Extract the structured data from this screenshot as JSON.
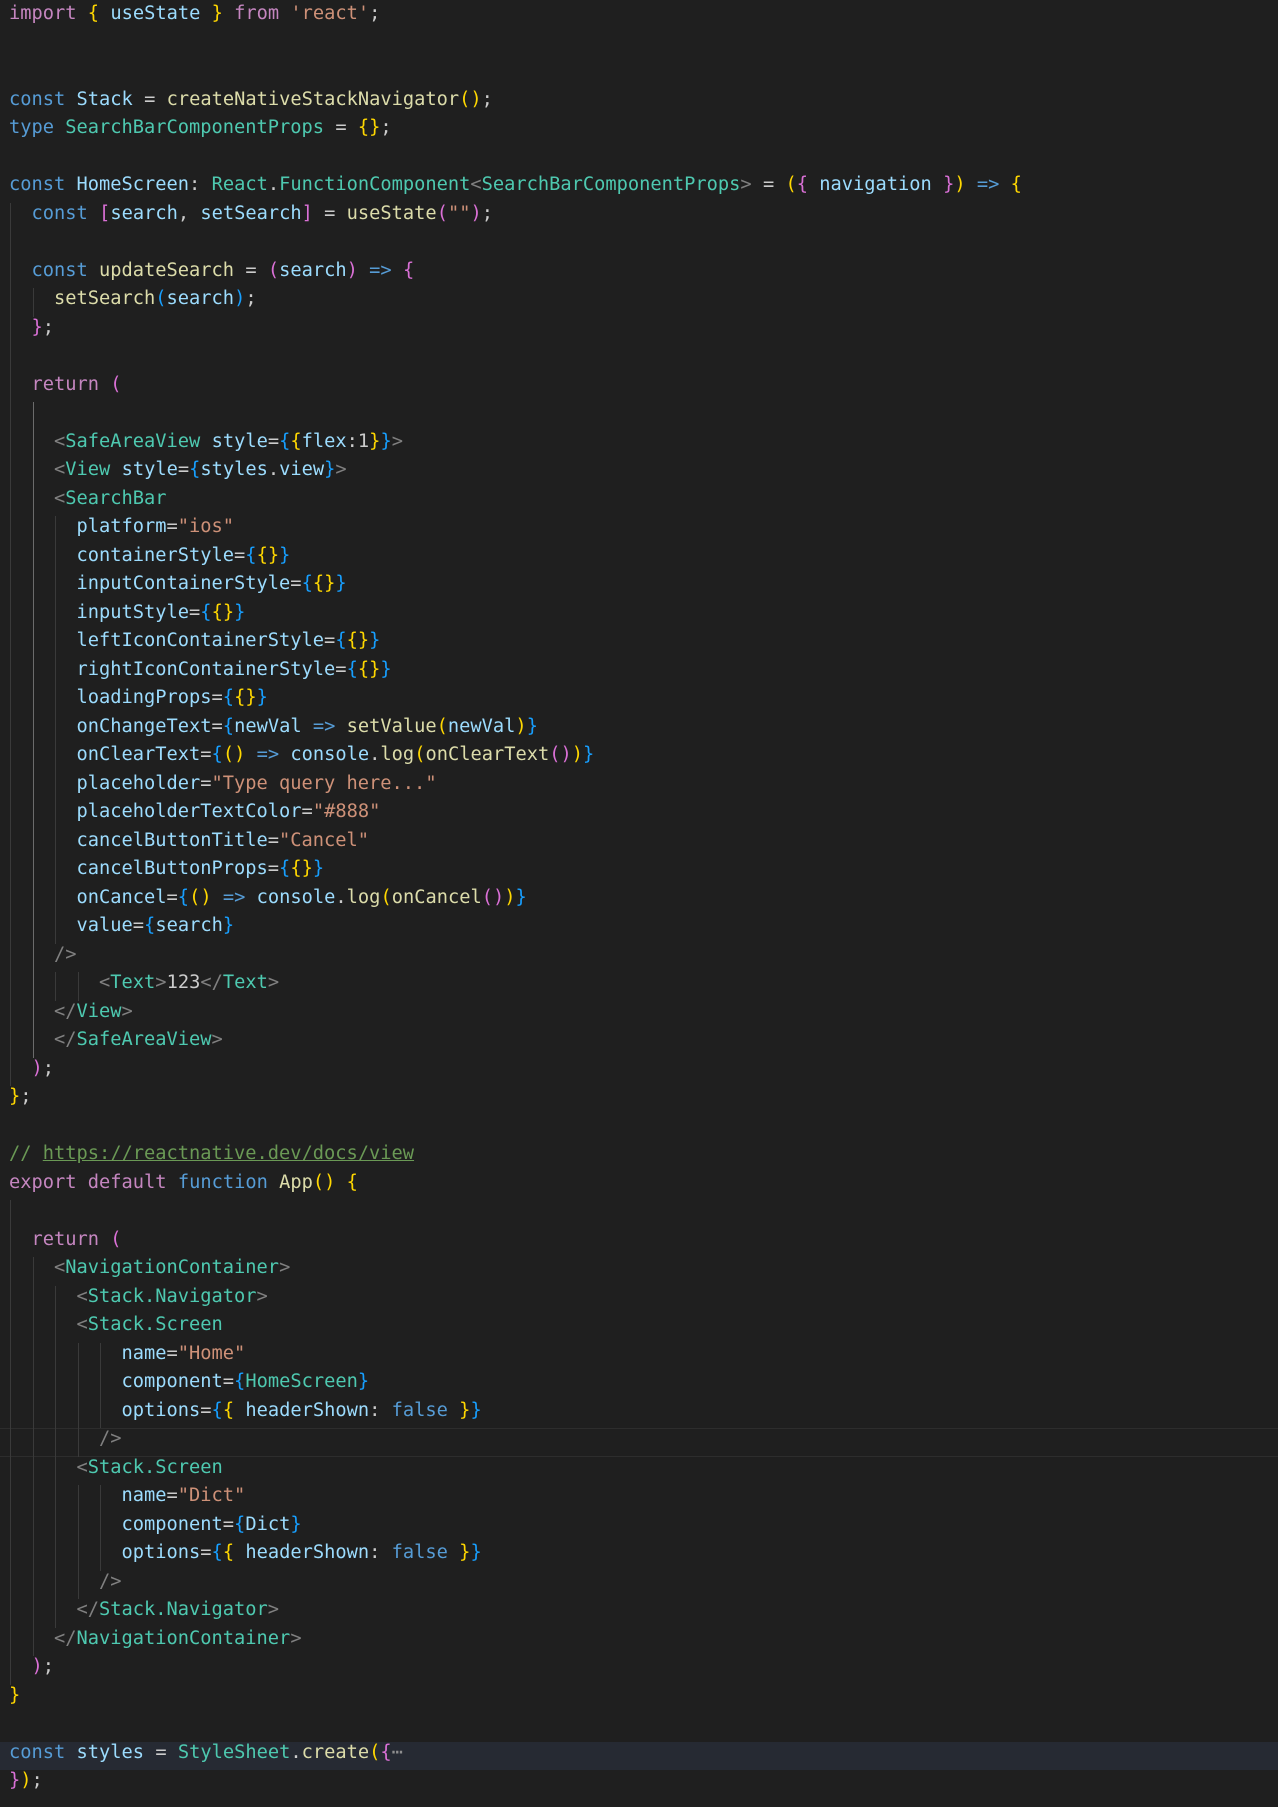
{
  "editor": {
    "language": "tsx",
    "theme": "dark",
    "lines": {
      "l1": [
        "import",
        "{",
        "useState",
        "}",
        "from",
        "'react'",
        ";"
      ],
      "l4": [
        "const",
        "Stack",
        "=",
        "createNativeStackNavigator",
        "(",
        ")",
        ";"
      ],
      "l5": [
        "type",
        "SearchBarComponentProps",
        "=",
        "{",
        "}",
        ";"
      ],
      "l7": [
        "const",
        "HomeScreen",
        ":",
        "React",
        ".",
        "FunctionComponent",
        "<",
        "SearchBarComponentProps",
        ">",
        "=",
        "(",
        "{",
        "navigation",
        "}",
        ")",
        "=>",
        "{"
      ],
      "l8": [
        "const",
        "[",
        "search",
        ", ",
        "setSearch",
        "]",
        "=",
        "useState",
        "(",
        "\"\"",
        ")",
        ";"
      ],
      "l10": [
        "const",
        "updateSearch",
        "=",
        "(",
        "search",
        ")",
        "=>",
        "{"
      ],
      "l11": [
        "setSearch",
        "(",
        "search",
        ")",
        ";"
      ],
      "l12": [
        "}",
        ";"
      ],
      "l14": [
        "return",
        "("
      ],
      "l16": [
        "<",
        "SafeAreaView",
        "style",
        "=",
        "{",
        "{",
        "flex",
        ":",
        "1",
        "}",
        "}",
        ">"
      ],
      "l17": [
        "<",
        "View",
        "style",
        "=",
        "{",
        "styles",
        ".",
        "view",
        "}",
        ">"
      ],
      "l18": [
        "<",
        "SearchBar"
      ],
      "l19": [
        "platform",
        "=",
        "\"ios\""
      ],
      "l20": [
        "containerStyle",
        "=",
        "{",
        "{",
        "}",
        "}"
      ],
      "l21": [
        "inputContainerStyle",
        "=",
        "{",
        "{",
        "}",
        "}"
      ],
      "l22": [
        "inputStyle",
        "=",
        "{",
        "{",
        "}",
        "}"
      ],
      "l23": [
        "leftIconContainerStyle",
        "=",
        "{",
        "{",
        "}",
        "}"
      ],
      "l24": [
        "rightIconContainerStyle",
        "=",
        "{",
        "{",
        "}",
        "}"
      ],
      "l25": [
        "loadingProps",
        "=",
        "{",
        "{",
        "}",
        "}"
      ],
      "l26": [
        "onChangeText",
        "=",
        "{",
        "newVal",
        "=>",
        "setValue",
        "(",
        "newVal",
        ")",
        "}"
      ],
      "l27": [
        "onClearText",
        "=",
        "{",
        "(",
        ")",
        "=>",
        "console",
        ".",
        "log",
        "(",
        "onClearText",
        "(",
        ")",
        ")",
        "}"
      ],
      "l28": [
        "placeholder",
        "=",
        "\"Type query here...\""
      ],
      "l29": [
        "placeholderTextColor",
        "=",
        "\"#888\""
      ],
      "l30": [
        "cancelButtonTitle",
        "=",
        "\"Cancel\""
      ],
      "l31": [
        "cancelButtonProps",
        "=",
        "{",
        "{",
        "}",
        "}"
      ],
      "l32": [
        "onCancel",
        "=",
        "{",
        "(",
        ")",
        "=>",
        "console",
        ".",
        "log",
        "(",
        "onCancel",
        "(",
        ")",
        ")",
        "}"
      ],
      "l33": [
        "value",
        "=",
        "{",
        "search",
        "}"
      ],
      "l34": [
        "/>"
      ],
      "l35": [
        "<",
        "Text",
        ">",
        "123",
        "</",
        "Text",
        ">"
      ],
      "l36": [
        "</",
        "View",
        ">"
      ],
      "l37": [
        "</",
        "SafeAreaView",
        ">"
      ],
      "l38": [
        ")",
        ";"
      ],
      "l39": [
        "}",
        ";"
      ],
      "l41": [
        "// ",
        "https://reactnative.dev/docs/view"
      ],
      "l42": [
        "export",
        "default",
        "function",
        "App",
        "(",
        ")",
        "{"
      ],
      "l44": [
        "return",
        "("
      ],
      "l45": [
        "<",
        "NavigationContainer",
        ">"
      ],
      "l46": [
        "<",
        "Stack.Navigator",
        ">"
      ],
      "l47": [
        "<",
        "Stack.Screen"
      ],
      "l48": [
        "name",
        "=",
        "\"Home\""
      ],
      "l49": [
        "component",
        "=",
        "{",
        "HomeScreen",
        "}"
      ],
      "l50": [
        "options",
        "=",
        "{",
        "{",
        "headerShown",
        ":",
        "false",
        "}",
        "}"
      ],
      "l51": [
        "/>"
      ],
      "l52": [
        "<",
        "Stack.Screen"
      ],
      "l53": [
        "name",
        "=",
        "\"Dict\""
      ],
      "l54": [
        "component",
        "=",
        "{",
        "Dict",
        "}"
      ],
      "l55": [
        "options",
        "=",
        "{",
        "{",
        "headerShown",
        ":",
        "false",
        "}",
        "}"
      ],
      "l56": [
        "/>"
      ],
      "l57": [
        "</",
        "Stack.Navigator",
        ">"
      ],
      "l58": [
        "</",
        "NavigationContainer",
        ">"
      ],
      "l59": [
        ")",
        ";"
      ],
      "l60": [
        "}"
      ],
      "l62": [
        "const",
        "styles",
        "=",
        "StyleSheet",
        ".",
        "create",
        "(",
        "{",
        "⋯"
      ],
      "l63": [
        "}",
        ")",
        ";"
      ]
    }
  },
  "colors": {
    "background": "#1f1f1f",
    "keyword": "#c586c0",
    "storage": "#569cd6",
    "variable": "#9cdcfe",
    "type": "#4ec9b0",
    "function": "#dcdcaa",
    "string": "#ce9178",
    "comment": "#6a9955",
    "tag_bracket": "#808080",
    "bracket_1": "#ffd700",
    "bracket_2": "#da70d6",
    "bracket_3": "#179fff"
  }
}
